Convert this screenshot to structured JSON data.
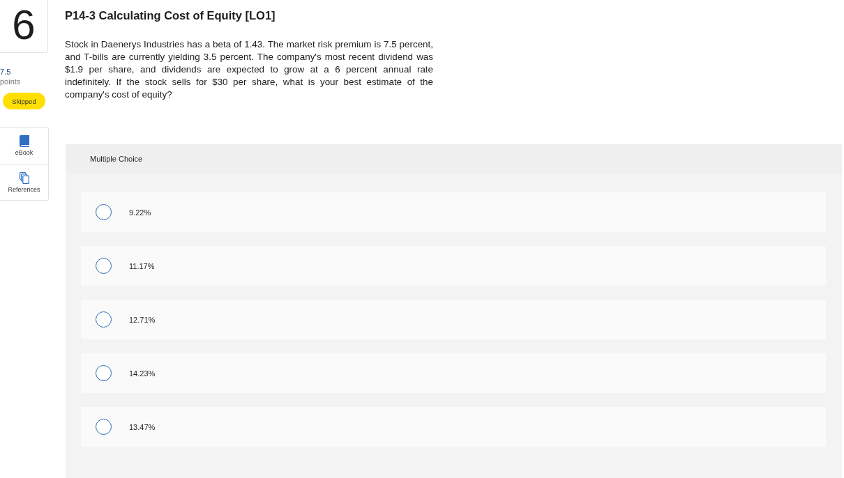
{
  "question": {
    "number": "6",
    "points": "7.5",
    "points_label": "points",
    "status": "Skipped"
  },
  "tools": [
    {
      "label": "eBook",
      "kind": "ebook"
    },
    {
      "label": "References",
      "kind": "references"
    }
  ],
  "problem": {
    "title": "P14-3 Calculating Cost of Equity [LO1]",
    "text": "Stock in Daenerys Industries has a beta of 1.43. The market risk premium is 7.5 percent, and T-bills are currently yielding 3.5 percent. The company's most recent dividend was $1.9 per share, and dividends are expected to grow at a 6 percent annual rate indefinitely. If the stock sells for $30 per share, what is your best estimate of the company's cost of equity?"
  },
  "answer": {
    "type": "Multiple Choice",
    "options": [
      {
        "label": "9.22%",
        "selected": false
      },
      {
        "label": "11.17%",
        "selected": false
      },
      {
        "label": "12.71%",
        "selected": false
      },
      {
        "label": "14.23%",
        "selected": false
      },
      {
        "label": "13.47%",
        "selected": false
      }
    ]
  }
}
